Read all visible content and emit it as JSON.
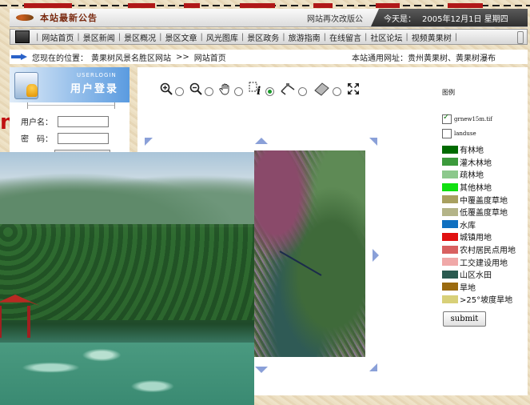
{
  "header": {
    "logo_text": "本站最新公告",
    "notice": "网站再次改版公",
    "date_label": "今天是：",
    "date_value": "2005年12月1日 星期四"
  },
  "nav": {
    "items": [
      "网站首页",
      "景区新闻",
      "景区概况",
      "景区文章",
      "风光图库",
      "景区政务",
      "旅游指南",
      "在线留言",
      "社区论坛",
      "视频黄果树"
    ]
  },
  "location": {
    "label": "您现在的位置：",
    "site": "黄果树风景名胜区网站",
    "separator": ">>",
    "page": "网站首页",
    "right_text": "本站通用网址：贵州黄果树、黄果树瀑布"
  },
  "login": {
    "subtitle": "USERLOGIN",
    "title": "用户登录",
    "username_label": "用户名：",
    "password_label": "密　码："
  },
  "left_red_text": "n",
  "legend": {
    "title": "图例",
    "layers": [
      {
        "name": "grnew15m.tif",
        "checked": true
      },
      {
        "name": "landuse",
        "checked": false
      }
    ],
    "items": [
      {
        "label": "有林地",
        "color": "#006a00"
      },
      {
        "label": "灌木林地",
        "color": "#3c9a3c"
      },
      {
        "label": "疏林地",
        "color": "#8cc88c"
      },
      {
        "label": "其他林地",
        "color": "#10e010"
      },
      {
        "label": "中覆盖度草地",
        "color": "#a8a060"
      },
      {
        "label": "低覆盖度草地",
        "color": "#b4b488"
      },
      {
        "label": "水库",
        "color": "#1070c0"
      },
      {
        "label": "城镇用地",
        "color": "#e01010"
      },
      {
        "label": "农村居民点用地",
        "color": "#d86060"
      },
      {
        "label": "工交建设用地",
        "color": "#f0a8a8"
      },
      {
        "label": "山区水田",
        "color": "#2a5a50"
      },
      {
        "label": "旱地",
        "color": "#9a6a10"
      },
      {
        "label": ">25°坡度旱地",
        "color": "#d8d078"
      }
    ],
    "submit_label": "submit"
  },
  "colors": {
    "accent_red": "#b01818",
    "login_blue": "#5a9be0",
    "pan_arrow": "#8aa0d8"
  }
}
